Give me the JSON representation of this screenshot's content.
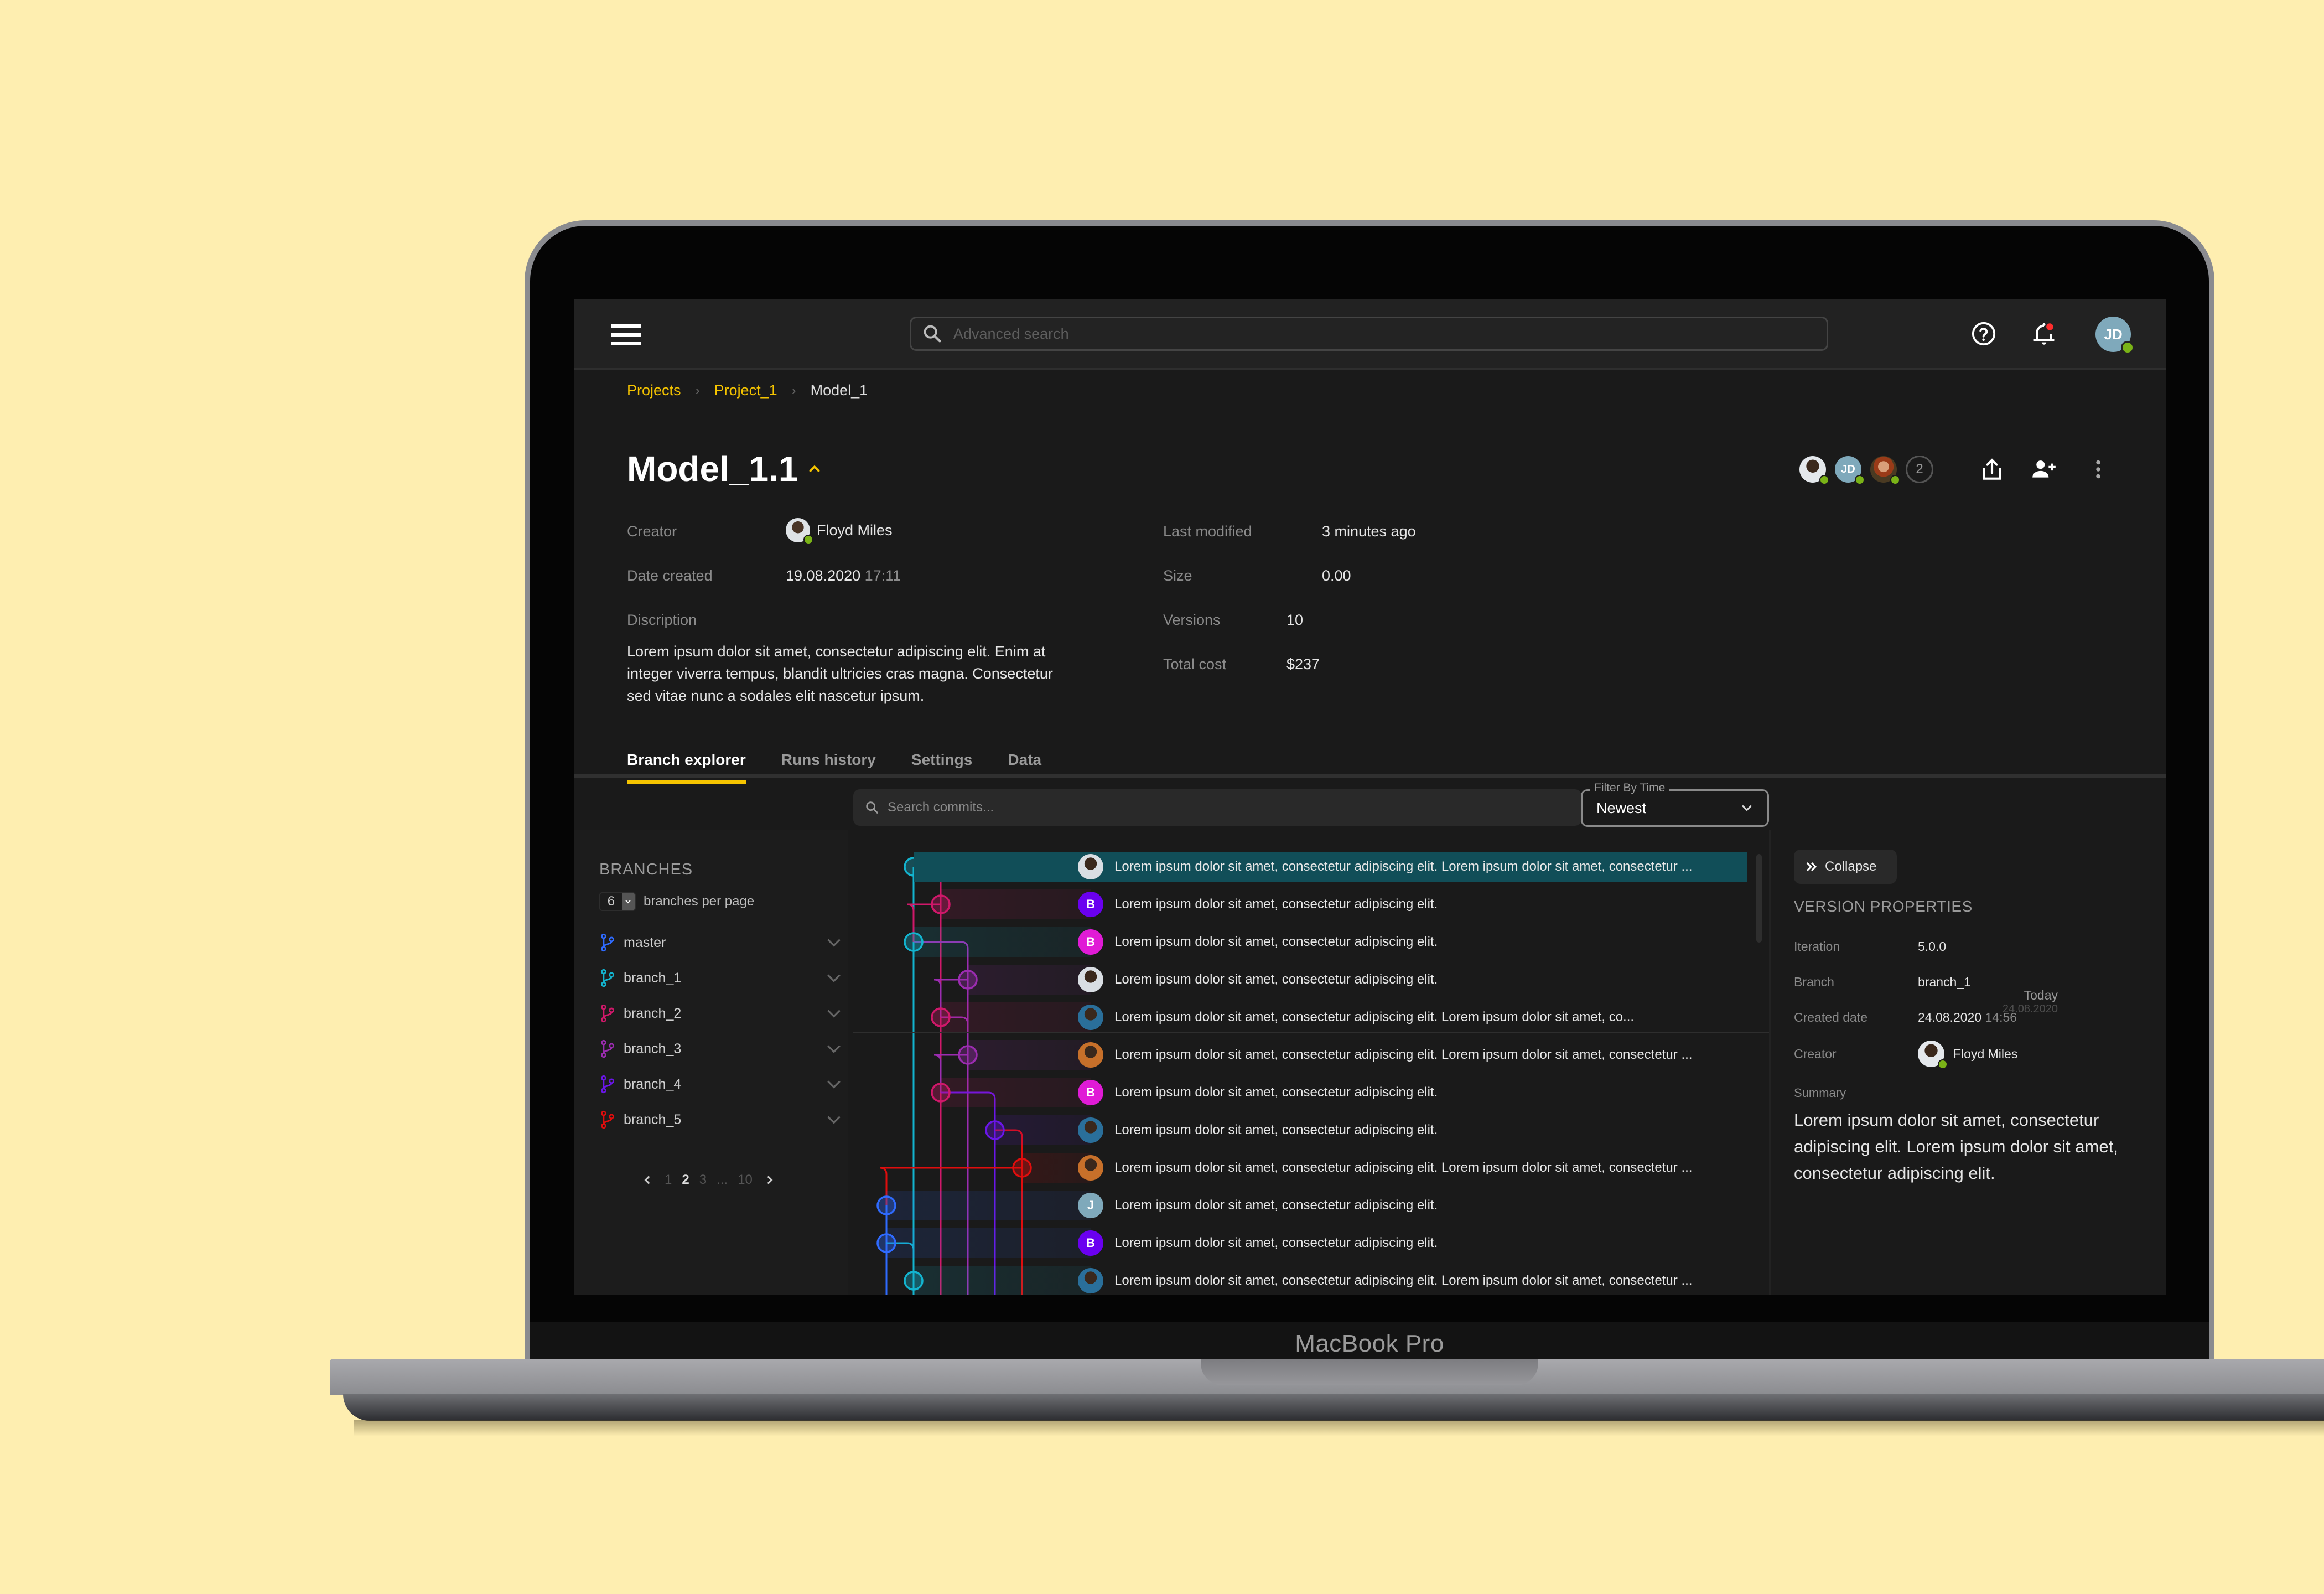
{
  "device": {
    "label": "MacBook Pro"
  },
  "topbar": {
    "search_placeholder": "Advanced search",
    "user_initials": "JD",
    "icons": {
      "menu": "hamburger-icon",
      "search": "search-icon",
      "help": "help-circle-icon",
      "notifications": "bell-icon"
    }
  },
  "breadcrumb": [
    {
      "label": "Projects",
      "link": true
    },
    {
      "label": "Project_1",
      "link": true
    },
    {
      "label": "Model_1",
      "link": false
    }
  ],
  "model": {
    "title": "Model_1.1",
    "creator_label": "Creator",
    "creator": "Floyd Miles",
    "date_created_label": "Date created",
    "date_created": "19.08.2020",
    "time_created": "17:11",
    "description_label": "Discription",
    "description": "Lorem ipsum dolor sit amet, consectetur adipiscing elit. Enim at integer viverra tempus, blandit ultricies cras magna. Consectetur sed vitae nunc a sodales elit nascetur ipsum.",
    "last_modified_label": "Last modified",
    "last_modified": "3 minutes ago",
    "size_label": "Size",
    "size": "0.00",
    "versions_label": "Versions",
    "versions": "10",
    "total_cost_label": "Total cost",
    "total_cost": "$237"
  },
  "collaborators": {
    "avatars": [
      {
        "type": "photo",
        "color": "#d9dee3"
      },
      {
        "type": "initials",
        "initials": "JD",
        "color": "#7fa9bb"
      },
      {
        "type": "photo",
        "color": "#b0562b"
      }
    ],
    "extra_count": "2"
  },
  "actions": {
    "share": "share-icon",
    "add_user": "add-user-icon",
    "more": "more-vertical-icon"
  },
  "tabs": [
    {
      "label": "Branch explorer",
      "active": true
    },
    {
      "label": "Runs history",
      "active": false
    },
    {
      "label": "Settings",
      "active": false
    },
    {
      "label": "Data",
      "active": false
    }
  ],
  "commit_search": {
    "placeholder": "Search commits..."
  },
  "filter": {
    "label": "Filter By Time",
    "value": "Newest"
  },
  "branches": {
    "title": "BRANCHES",
    "per_page": "6",
    "per_page_label": "branches per page",
    "items": [
      {
        "name": "master",
        "color": "#2f6bff"
      },
      {
        "name": "branch_1",
        "color": "#13b4cf"
      },
      {
        "name": "branch_2",
        "color": "#d0186a"
      },
      {
        "name": "branch_3",
        "color": "#9b2cb0"
      },
      {
        "name": "branch_4",
        "color": "#6a16e8"
      },
      {
        "name": "branch_5",
        "color": "#e00d0d"
      }
    ],
    "pagination": {
      "pages": [
        "1",
        "2",
        "3",
        "...",
        "10"
      ],
      "current": "2"
    }
  },
  "commits": [
    {
      "lane": 1,
      "avatar": {
        "type": "photo",
        "color": "#d9dee3"
      },
      "text": "Lorem ipsum dolor sit amet, consectetur adipiscing elit. Lorem ipsum dolor sit amet, consectetur ...",
      "selected": true
    },
    {
      "lane": 2,
      "avatar": {
        "type": "initials",
        "initials": "B",
        "color": "#6a00f0"
      },
      "text": "Lorem ipsum dolor sit amet, consectetur adipiscing elit.",
      "selected": false
    },
    {
      "lane": 1,
      "avatar": {
        "type": "initials",
        "initials": "B",
        "color": "#e01bd6"
      },
      "text": "Lorem ipsum dolor sit amet, consectetur adipiscing elit.",
      "selected": false
    },
    {
      "lane": 3,
      "avatar": {
        "type": "photo",
        "color": "#d9dee3"
      },
      "text": "Lorem ipsum dolor sit amet, consectetur adipiscing elit.",
      "selected": false
    },
    {
      "lane": 2,
      "avatar": {
        "type": "photo",
        "color": "#2a6f9a"
      },
      "text": "Lorem ipsum dolor sit amet, consectetur adipiscing elit. Lorem ipsum dolor sit amet, co...",
      "selected": false
    },
    {
      "lane": 3,
      "avatar": {
        "type": "photo",
        "color": "#c7702a"
      },
      "text": "Lorem ipsum dolor sit amet, consectetur adipiscing elit. Lorem ipsum dolor sit amet, consectetur ...",
      "selected": false
    },
    {
      "lane": 2,
      "avatar": {
        "type": "initials",
        "initials": "B",
        "color": "#e01bd6"
      },
      "text": "Lorem ipsum dolor sit amet, consectetur adipiscing elit.",
      "selected": false
    },
    {
      "lane": 4,
      "avatar": {
        "type": "photo",
        "color": "#2a6f9a"
      },
      "text": "Lorem ipsum dolor sit amet, consectetur adipiscing elit.",
      "selected": false
    },
    {
      "lane": 5,
      "avatar": {
        "type": "photo",
        "color": "#c7702a"
      },
      "text": "Lorem ipsum dolor sit amet, consectetur adipiscing elit. Lorem ipsum dolor sit amet, consectetur ...",
      "selected": false
    },
    {
      "lane": 0,
      "avatar": {
        "type": "initials",
        "initials": "J",
        "color": "#7fa9bb"
      },
      "text": "Lorem ipsum dolor sit amet, consectetur adipiscing elit.",
      "selected": false
    },
    {
      "lane": 0,
      "avatar": {
        "type": "initials",
        "initials": "B",
        "color": "#6a00f0"
      },
      "text": "Lorem ipsum dolor sit amet, consectetur adipiscing elit.",
      "selected": false
    },
    {
      "lane": 1,
      "avatar": {
        "type": "photo",
        "color": "#2a6f9a"
      },
      "text": "Lorem ipsum dolor sit amet, consectetur adipiscing elit. Lorem ipsum dolor sit amet, consectetur ...",
      "selected": false
    }
  ],
  "date_marker": {
    "label": "Today",
    "date": "24.08.2020"
  },
  "version_properties": {
    "collapse_label": "Collapse",
    "title": "VERSION PROPERTIES",
    "rows": [
      {
        "key": "Iteration",
        "value": "5.0.0"
      },
      {
        "key": "Branch",
        "value": "branch_1"
      },
      {
        "key": "Created date",
        "value": "24.08.2020",
        "extra": "14:56"
      },
      {
        "key": "Creator",
        "value": "Floyd Miles"
      }
    ],
    "summary_label": "Summary",
    "summary": "Lorem ipsum dolor sit amet, consectetur adipiscing elit. Lorem ipsum dolor sit amet, consectetur adipiscing elit."
  },
  "colors": {
    "accent": "#f5c400",
    "online": "#7ab317",
    "selected_row": "#114e58",
    "notification": "#ff2d2d"
  }
}
